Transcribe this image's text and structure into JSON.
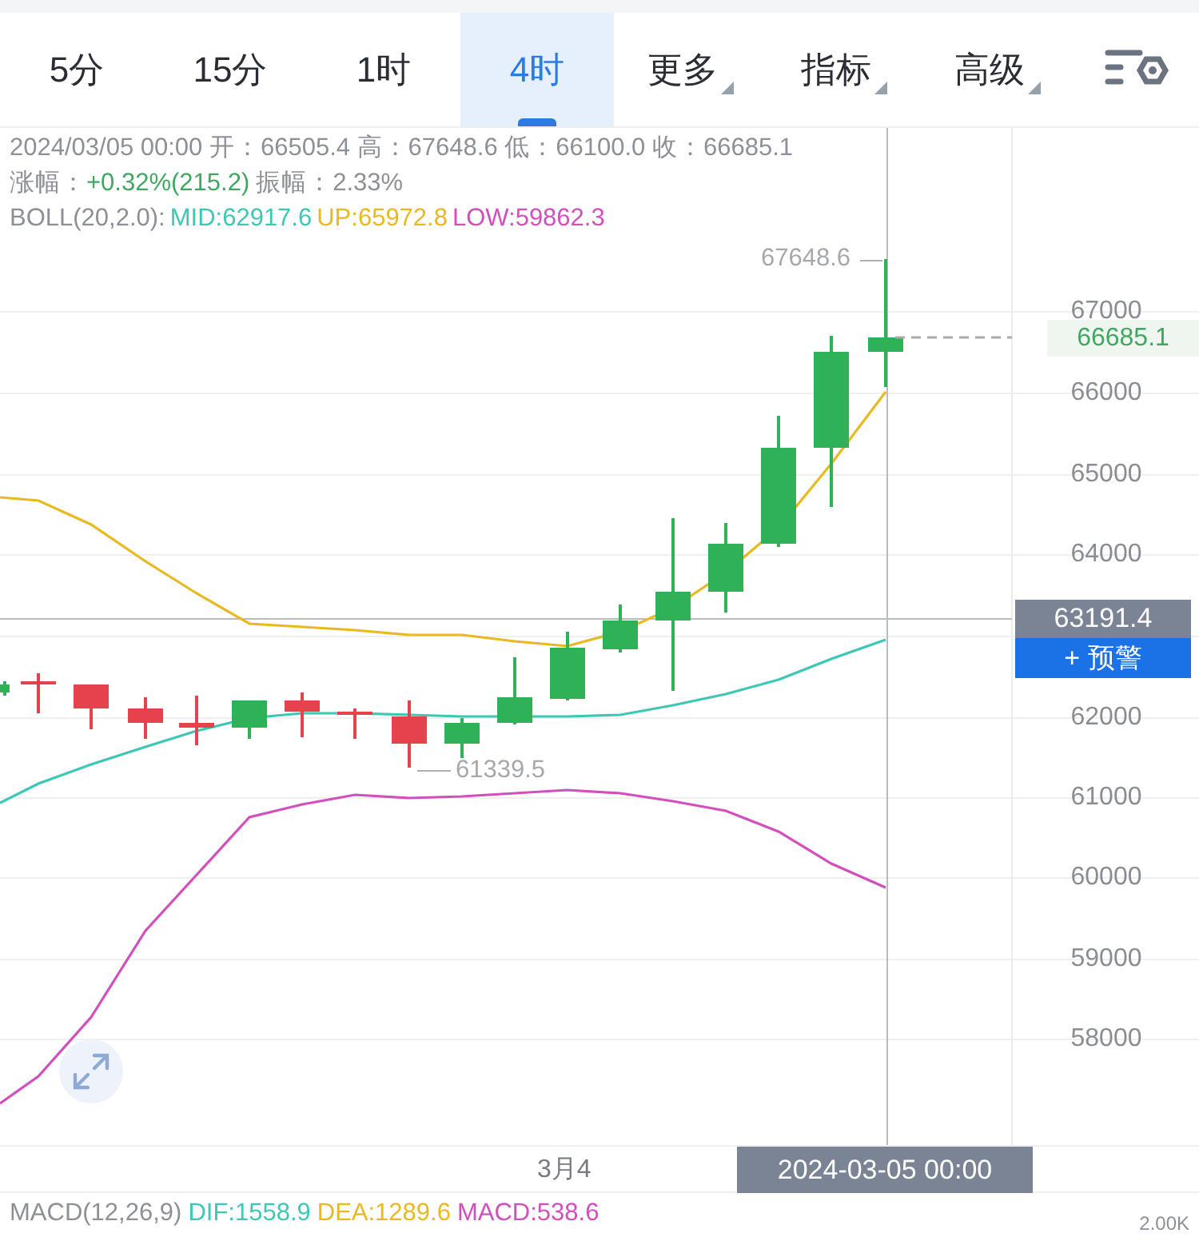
{
  "tabs": [
    {
      "label": "5分",
      "selected": false,
      "kind": "plain"
    },
    {
      "label": "15分",
      "selected": false,
      "kind": "plain"
    },
    {
      "label": "1时",
      "selected": false,
      "kind": "plain"
    },
    {
      "label": "4时",
      "selected": true,
      "kind": "plain"
    },
    {
      "label": "更多",
      "selected": false,
      "kind": "dropdown"
    },
    {
      "label": "指标",
      "selected": false,
      "kind": "dropdown"
    },
    {
      "label": "高级",
      "selected": false,
      "kind": "dropdown"
    }
  ],
  "info": {
    "ohlc": "2024/03/05 00:00 开：66505.4 高：67648.6 低：66100.0 收：66685.1",
    "change_label": "涨幅：",
    "change": "+0.32%(215.2)",
    "amplitude_label": "振幅：",
    "amplitude": "2.33%"
  },
  "boll": {
    "label": "BOLL(20,2.0):",
    "items": [
      {
        "text": "MID:62917.6",
        "color": "#3cc8b4"
      },
      {
        "text": "UP:65972.8",
        "color": "#e8b920"
      },
      {
        "text": "LOW:59862.3",
        "color": "#d24fbd"
      }
    ]
  },
  "chart": {
    "price_axis": [
      "67000",
      "66000",
      "65000",
      "64000",
      "62000",
      "61000",
      "60000",
      "59000",
      "58000"
    ],
    "last_price": "66685.1",
    "crosshair_price": "63191.4",
    "alert_button": "+ 预警",
    "high_marker": "67648.6",
    "low_marker": "61339.5"
  },
  "time_axis": {
    "label": "3月4",
    "crosshair_time": "2024-03-05 00:00"
  },
  "macd": {
    "label": "MACD(12,26,9)",
    "items": [
      {
        "text": "DIF:1558.9",
        "color": "#3cc8b4"
      },
      {
        "text": "DEA:1289.6",
        "color": "#e8b920"
      },
      {
        "text": "MACD:538.6",
        "color": "#d24fbd"
      }
    ],
    "axis_top": "2.00K"
  }
}
